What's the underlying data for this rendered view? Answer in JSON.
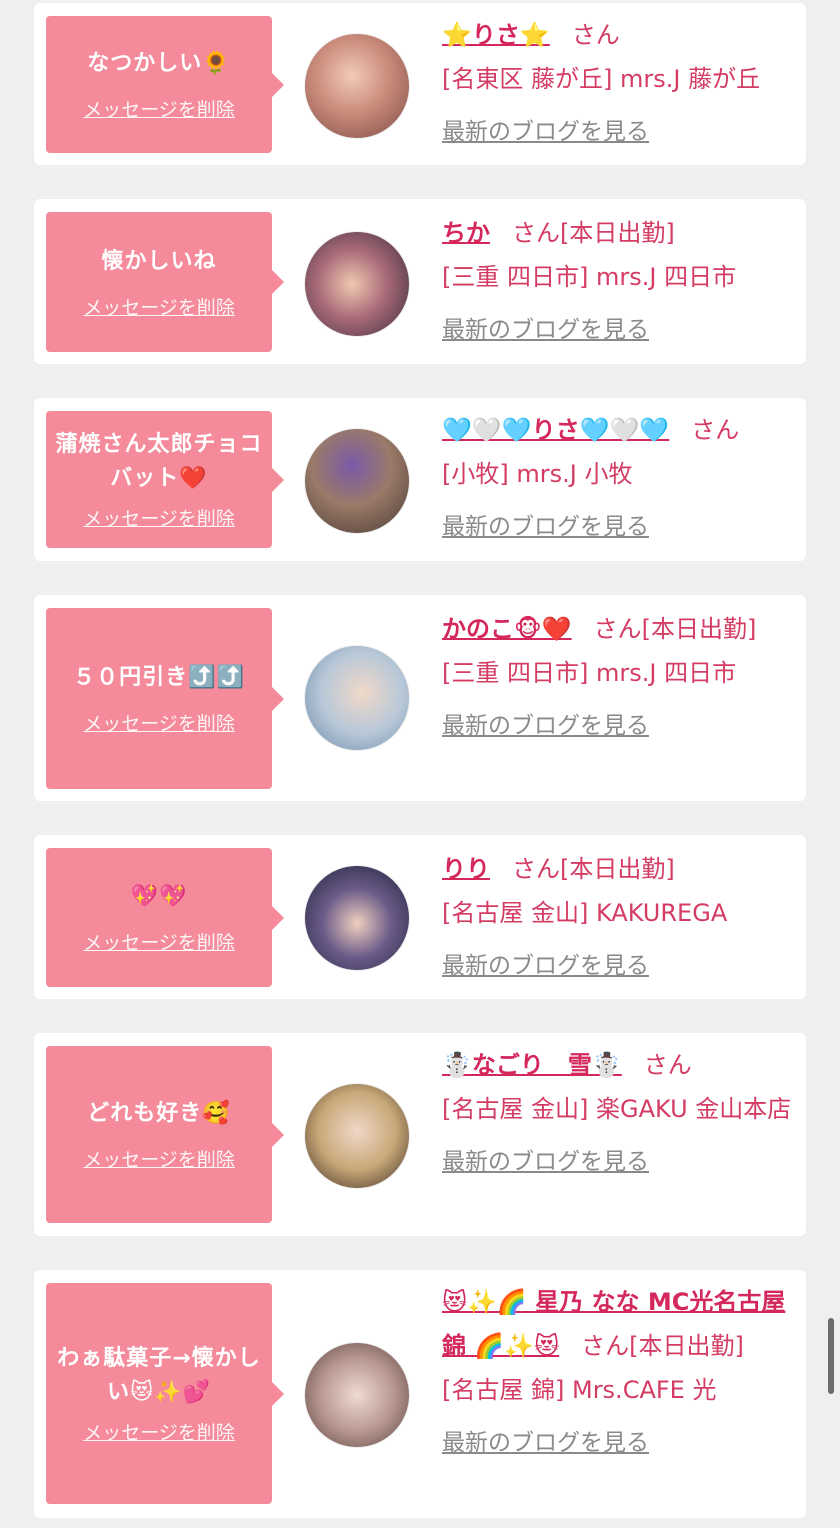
{
  "delete_label": "メッセージを削除",
  "blog_label": "最新のブログを見る",
  "san_label": "さん",
  "messages": [
    {
      "text": "なつかしい🌻",
      "name": "⭐りさ⭐",
      "status": "",
      "shop": "[名東区 藤が丘] mrs.J 藤が丘"
    },
    {
      "text": "懐かしいね",
      "name": "ちか",
      "status": "[本日出勤]",
      "shop": "[三重 四日市] mrs.J 四日市"
    },
    {
      "text": "蒲焼さん太郎チョコバット❤️",
      "name": "🩵🤍🩵りさ🩵🤍🩵",
      "status": "",
      "shop": "[小牧] mrs.J 小牧"
    },
    {
      "text": "５０円引き⤴️⤴️",
      "name": "かのこ🐵❤️",
      "status": "[本日出勤]",
      "shop": "[三重 四日市] mrs.J 四日市"
    },
    {
      "text": "💖💖",
      "name": "りり",
      "status": "[本日出勤]",
      "shop": "[名古屋 金山] KAKUREGA"
    },
    {
      "text": "どれも好き🥰",
      "name": "☃️なごり　雪☃️",
      "status": "",
      "shop": "[名古屋 金山] 楽GAKU 金山本店"
    },
    {
      "text": "わぁ駄菓子→懐かしい😻✨💕",
      "name": "😻✨🌈 星乃 なな MC光名古屋 錦 🌈✨😻",
      "status": "[本日出勤]",
      "shop": "[名古屋 錦] Mrs.CAFE 光"
    }
  ],
  "avatar_colors": [
    "#c98a7a",
    "#8a5a6a",
    "#9a7a68",
    "#b8c8d8",
    "#2a2f48",
    "#c8a878",
    "#b89890"
  ]
}
